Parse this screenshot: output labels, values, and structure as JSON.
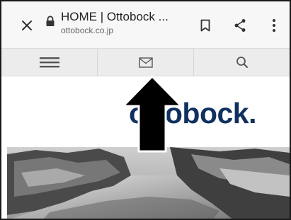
{
  "browser": {
    "page_title": "HOME | Ottobock ...",
    "url": "ottobock.co.jp",
    "icons": {
      "close": "close-icon",
      "lock": "lock-icon",
      "bookmark": "bookmark-icon",
      "share": "share-icon",
      "more": "more-vert-icon"
    }
  },
  "site_nav": {
    "items": [
      {
        "icon": "menu-icon"
      },
      {
        "icon": "mail-icon"
      },
      {
        "icon": "search-icon"
      }
    ]
  },
  "site": {
    "logo_text": "ottobock.",
    "hero_image": "rocky-coastline-photo"
  },
  "colors": {
    "brand": "#10305f",
    "toolbar_bg": "#f7f7f7",
    "nav_bg": "#ececec"
  }
}
